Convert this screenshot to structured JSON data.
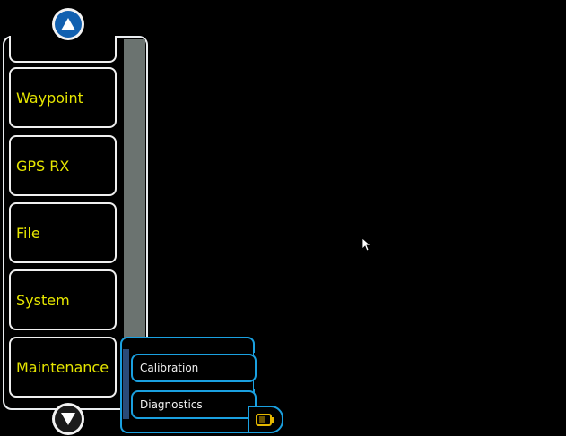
{
  "menu": {
    "items": [
      {
        "label": ""
      },
      {
        "label": "Waypoint"
      },
      {
        "label": "GPS RX"
      },
      {
        "label": "File"
      },
      {
        "label": "System"
      },
      {
        "label": "Maintenance"
      }
    ],
    "scroll_up_icon": "triangle-up-icon",
    "scroll_down_icon": "triangle-down-icon"
  },
  "submenu": {
    "items": [
      {
        "label": "Calibration"
      },
      {
        "label": "Diagnostics"
      }
    ]
  },
  "status": {
    "icon": "battery-icon",
    "icon_color": "#e6b800"
  },
  "colors": {
    "menu_text": "#e6e600",
    "submenu_border": "#1aa0e0",
    "scrollbar": "#6b7370"
  }
}
